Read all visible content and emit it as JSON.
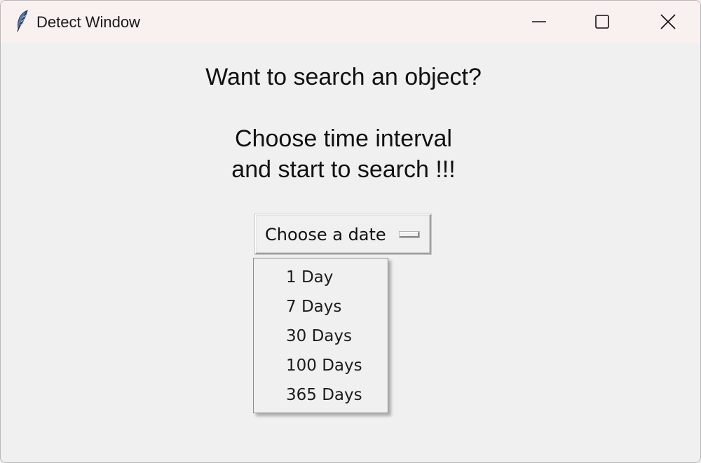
{
  "window": {
    "title": "Detect Window",
    "icon": "feather-icon",
    "controls": {
      "minimize_icon": "minimize-icon",
      "maximize_icon": "maximize-icon",
      "close_icon": "close-icon"
    }
  },
  "content": {
    "heading_line1": "Want to search an object?",
    "heading_line2": "Choose time interval",
    "heading_line3": "and start to search !!!"
  },
  "dropdown": {
    "selected_label": "Choose a date",
    "options": [
      "1 Day",
      "7 Days",
      "30 Days",
      "100 Days",
      "365 Days"
    ]
  },
  "colors": {
    "titlebar": "#f9f1f0",
    "window_bg": "#f0f0f0",
    "text": "#111111"
  }
}
